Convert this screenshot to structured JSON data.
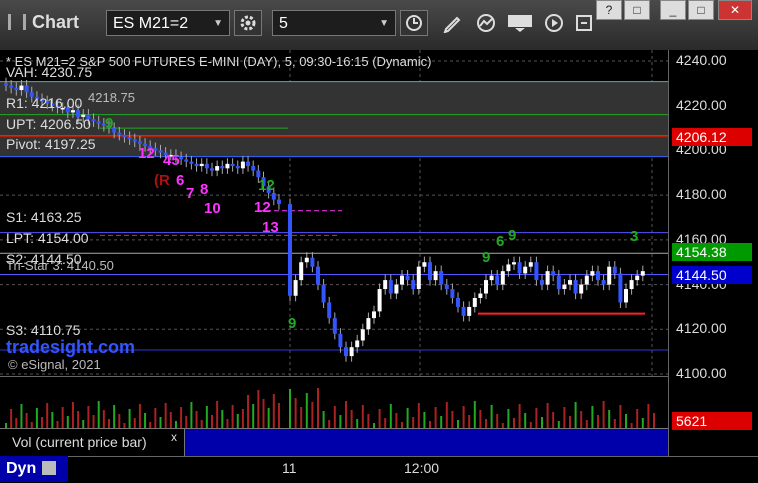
{
  "toolbar": {
    "brand": "Chart",
    "symbol": "ES M21=2",
    "interval": "5",
    "window_buttons": [
      "?",
      "□",
      "_",
      "□",
      "✕"
    ]
  },
  "header": "* ES M21=2  S&P 500 FUTURES E-MINI (DAY), 5, 09:30-16:15 (Dynamic)",
  "levels": [
    {
      "label": "VAH: 4230.75",
      "price": 4230.75
    },
    {
      "label": "R1: 4216.00",
      "price": 4216.0
    },
    {
      "label": "UPT: 4206.50",
      "price": 4206.5
    },
    {
      "label": "Pivot: 4197.25",
      "price": 4197.25
    },
    {
      "label": "S1: 4163.25",
      "price": 4163.25
    },
    {
      "label": "LPT: 4154.00",
      "price": 4154.0
    },
    {
      "label": "S2: 4144.50",
      "price": 4144.5
    },
    {
      "label": "S3: 4110.75",
      "price": 4110.75
    }
  ],
  "overlapped_labels": [
    "4218.75",
    "Tri-Star 3: 4140.50"
  ],
  "watermark": "tradesight.com",
  "copyright": "© eSignal, 2021",
  "price_tags": [
    {
      "value": "4206.12",
      "bg": "#dd0000",
      "fg": "#ffffff",
      "price": 4206.12
    },
    {
      "value": "4154.38",
      "bg": "#009900",
      "fg": "#ffffff",
      "price": 4154.38
    },
    {
      "value": "4144.50",
      "bg": "#0000cc",
      "fg": "#ffffff",
      "price": 4144.5
    }
  ],
  "volume": {
    "panel_label": "Vol (current price bar)",
    "close_glyph": "x",
    "tag": "5621",
    "tag_bg": "#dd0000"
  },
  "x_ticks": [
    "11",
    "12:00"
  ],
  "dyn_label": "Dyn",
  "counts": [
    "9",
    "12",
    "45",
    "(R",
    "6",
    "7",
    "8",
    "10",
    "12",
    "12",
    "13",
    "9",
    "6",
    "9",
    "3",
    "9"
  ],
  "chart_data": {
    "type": "candlestick",
    "title": "* ES M21=2  S&P 500 FUTURES E-MINI (DAY), 5, 09:30-16:15 (Dynamic)",
    "ylim": [
      4100,
      4240
    ],
    "y_ticks": [
      4100,
      4120,
      4140,
      4160,
      4180,
      4200,
      4220,
      4240
    ],
    "x_ticks": [
      "11",
      "12:00"
    ],
    "grid": true,
    "closes": [
      4229,
      4228,
      4227,
      4229,
      4226,
      4224,
      4223,
      4222,
      4221,
      4220,
      4219,
      4219,
      4217,
      4218,
      4215,
      4216,
      4214,
      4213,
      4212,
      4211,
      4210,
      4208,
      4207,
      4206,
      4205,
      4204,
      4203,
      4202,
      4201,
      4200,
      4199,
      4198,
      4198,
      4197,
      4196,
      4195,
      4194,
      4193,
      4194,
      4192,
      4191,
      4193,
      4192,
      4194,
      4193,
      4192,
      4195,
      4193,
      4191,
      4188,
      4184,
      4181,
      4178,
      4176,
      4135,
      4142,
      4150,
      4152,
      4148,
      4140,
      4132,
      4125,
      4118,
      4112,
      4108,
      4112,
      4115,
      4120,
      4125,
      4128,
      4138,
      4142,
      4136,
      4140,
      4144,
      4142,
      4138,
      4148,
      4150,
      4142,
      4146,
      4140,
      4138,
      4134,
      4130,
      4126,
      4130,
      4134,
      4136,
      4142,
      4144,
      4140,
      4146,
      4149,
      4150,
      4145,
      4148,
      4150,
      4142,
      4140,
      4146,
      4144,
      4138,
      4140,
      4142,
      4136,
      4140,
      4144,
      4146,
      4142,
      4140,
      4148,
      4145,
      4132,
      4138,
      4142,
      4144,
      4146
    ]
  }
}
